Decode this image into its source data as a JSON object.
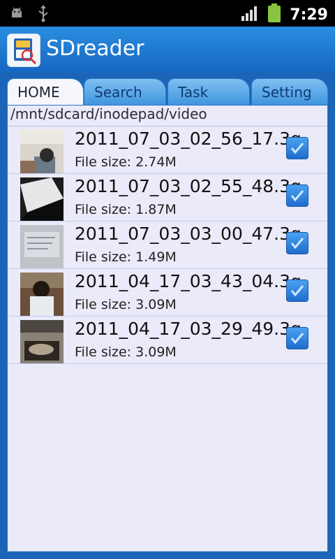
{
  "status_bar": {
    "time": "7:29",
    "icons": [
      "android-debug-icon",
      "usb-icon",
      "signal-icon",
      "battery-icon"
    ]
  },
  "app": {
    "title": "SDreader",
    "icon": "sd-card-icon"
  },
  "tabs": [
    {
      "label": "HOME",
      "active": true
    },
    {
      "label": "Search",
      "active": false
    },
    {
      "label": "Task",
      "active": false
    },
    {
      "label": "Setting",
      "active": false
    }
  ],
  "path": "/mnt/sdcard/inodepad/video",
  "files": [
    {
      "name": "2011_07_03_02_56_17.3g",
      "size": "File size: 2.74M",
      "checked": true
    },
    {
      "name": "2011_07_03_02_55_48.3g",
      "size": "File size: 1.87M",
      "checked": true
    },
    {
      "name": "2011_07_03_03_00_47.3g",
      "size": "File size: 1.49M",
      "checked": true
    },
    {
      "name": "2011_04_17_03_43_04.3g",
      "size": "File size: 3.09M",
      "checked": true
    },
    {
      "name": "2011_04_17_03_29_49.3g",
      "size": "File size: 3.09M",
      "checked": true
    }
  ],
  "colors": {
    "accent": "#1c64b8",
    "panel": "#eaeaf8",
    "checkbox": "#2f80dd"
  }
}
